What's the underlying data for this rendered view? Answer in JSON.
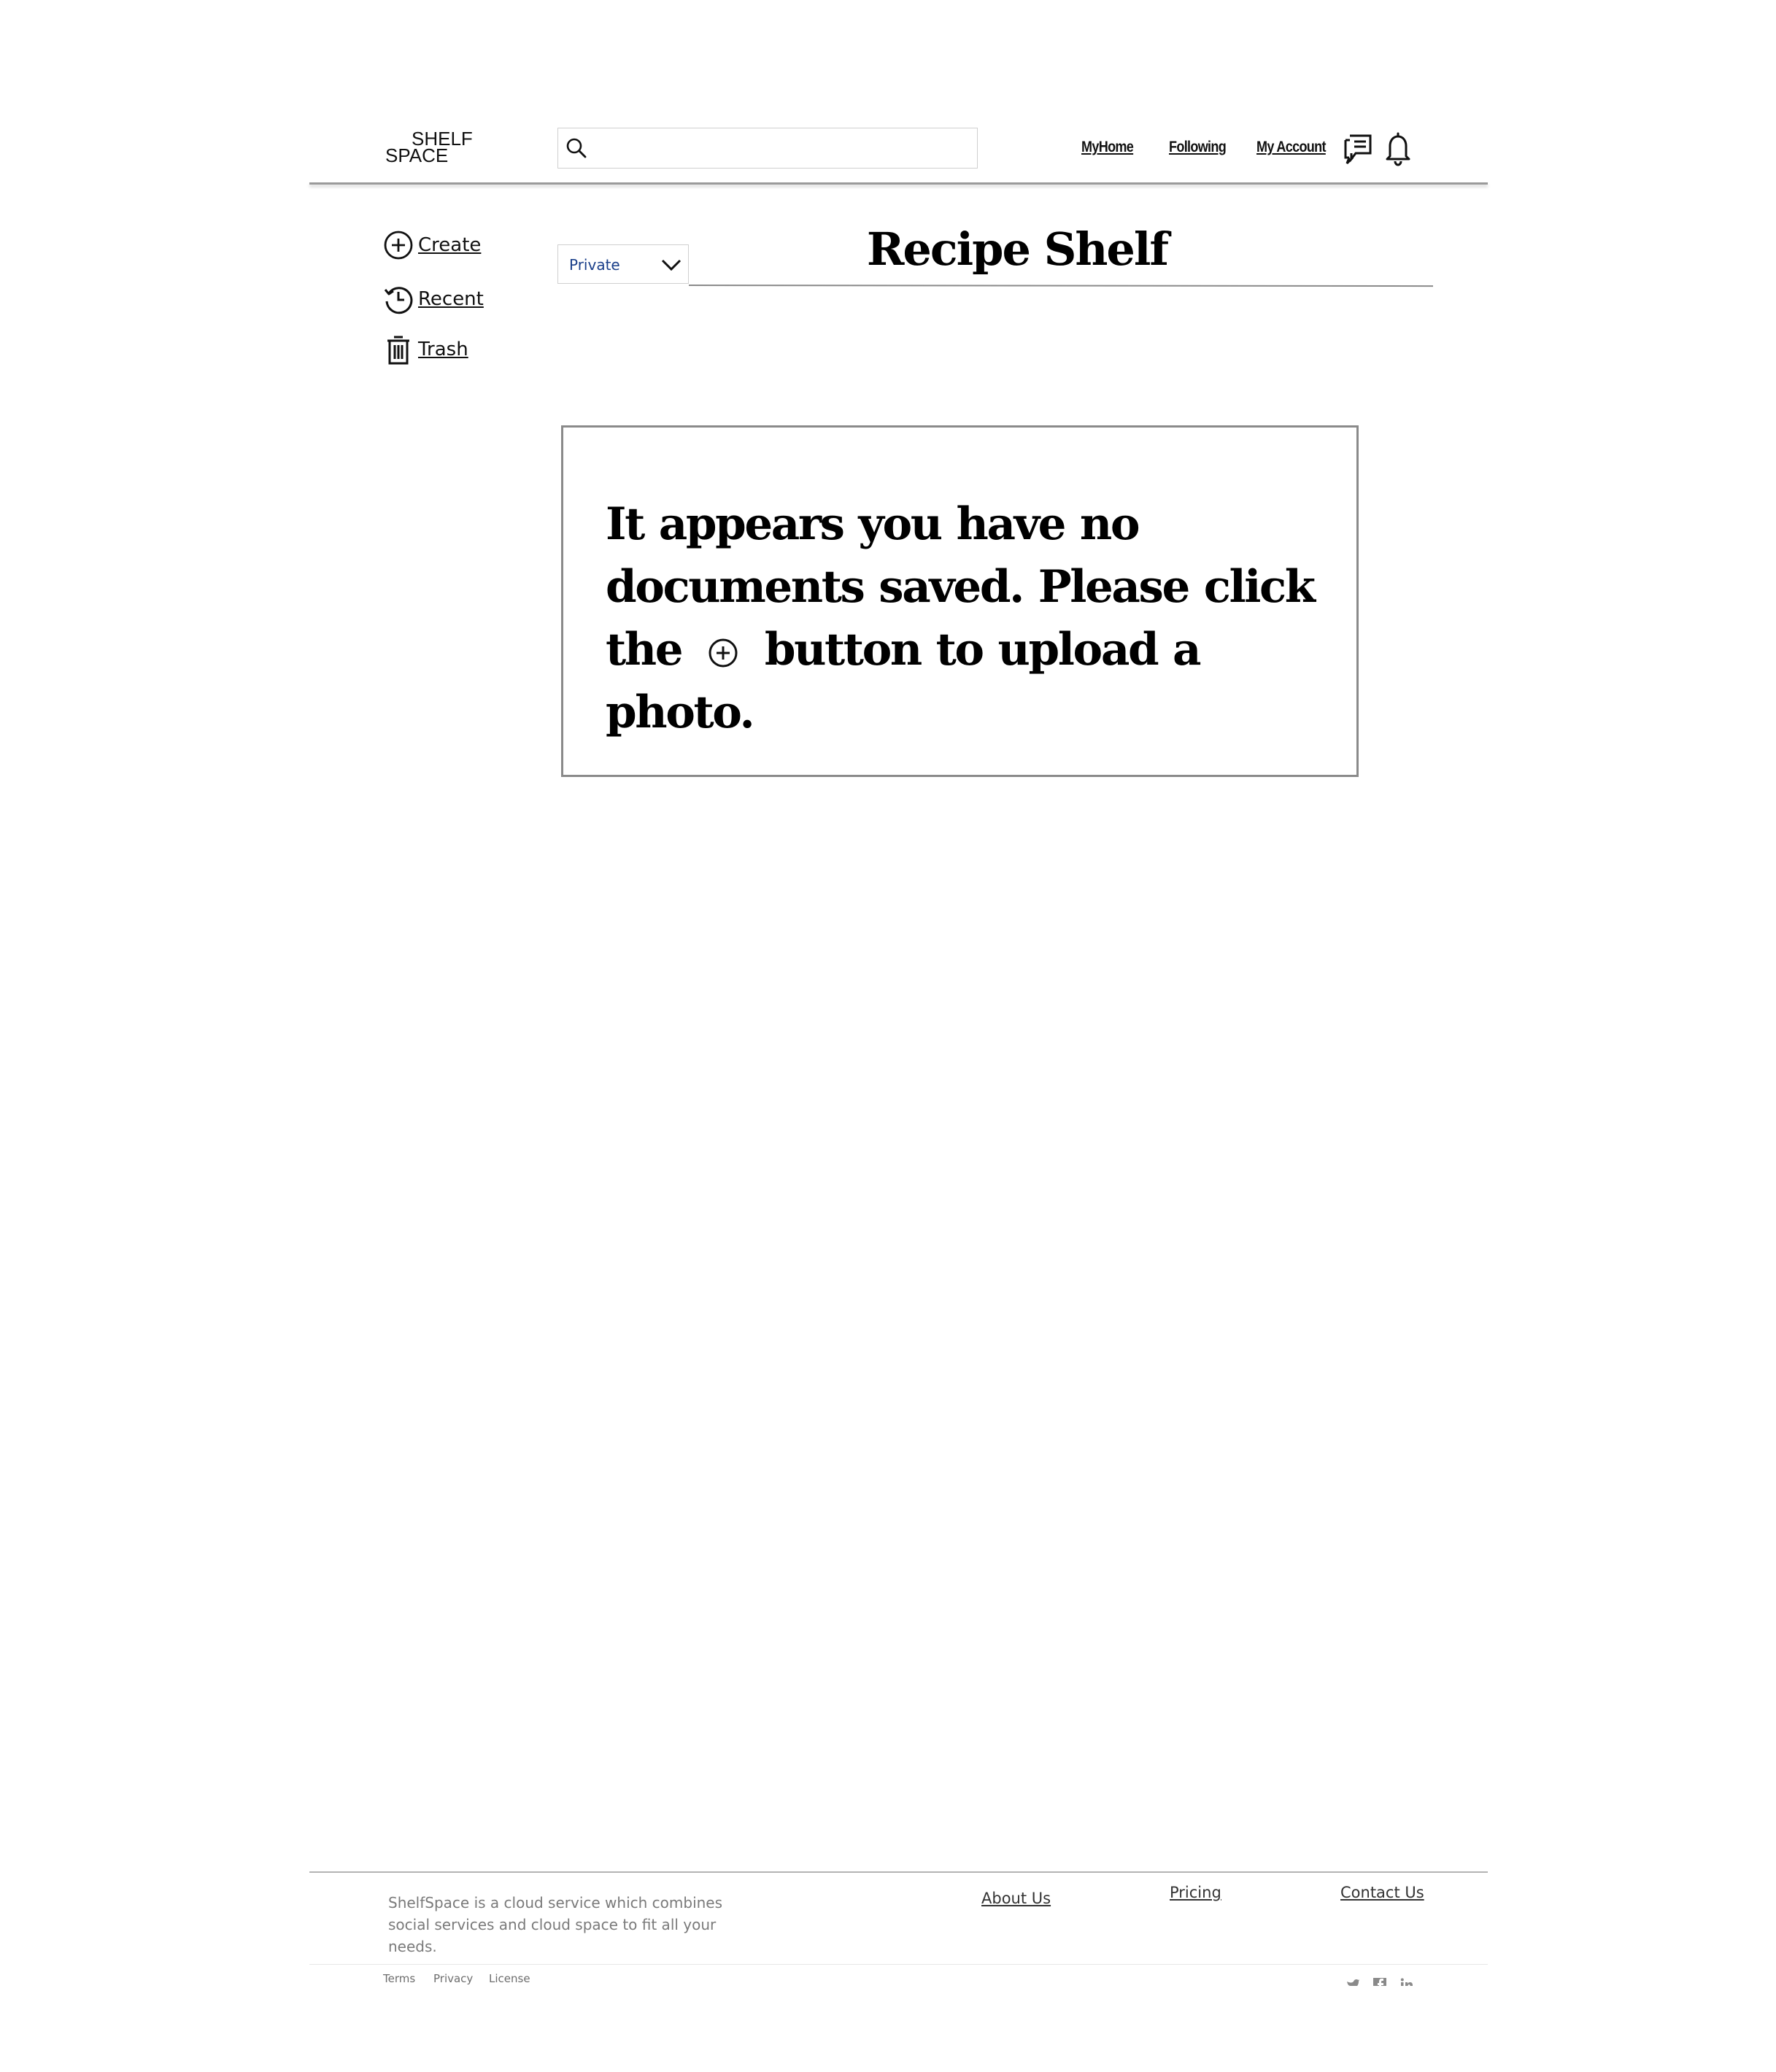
{
  "brand": {
    "logo_top": "SHELF",
    "logo_bottom": "SPACE"
  },
  "search": {
    "placeholder": "",
    "value": ""
  },
  "nav": {
    "links": [
      "MyHome",
      "Following",
      "My Account"
    ]
  },
  "sidebar": {
    "items": [
      {
        "label": "Create"
      },
      {
        "label": "Recent"
      },
      {
        "label": "Trash"
      }
    ]
  },
  "shelf": {
    "visibility": "Private",
    "title": "Recipe Shelf"
  },
  "empty_state": {
    "text_before": "It appears you have no documents saved. Please click the",
    "text_after": "button to upload a photo."
  },
  "footer": {
    "description": "ShelfSpace is a cloud service which combines social services and cloud space to fit all your needs.",
    "links": [
      "About Us",
      "Pricing",
      "Contact Us"
    ],
    "legal": [
      "Terms",
      "Privacy",
      "License"
    ],
    "social_icons": [
      "twitter-icon",
      "facebook-icon",
      "linkedin-icon"
    ]
  },
  "colors": {
    "select_text": "#1a3f8a",
    "rule": "#9a9a9a",
    "footer_text": "#7a7a7a"
  }
}
